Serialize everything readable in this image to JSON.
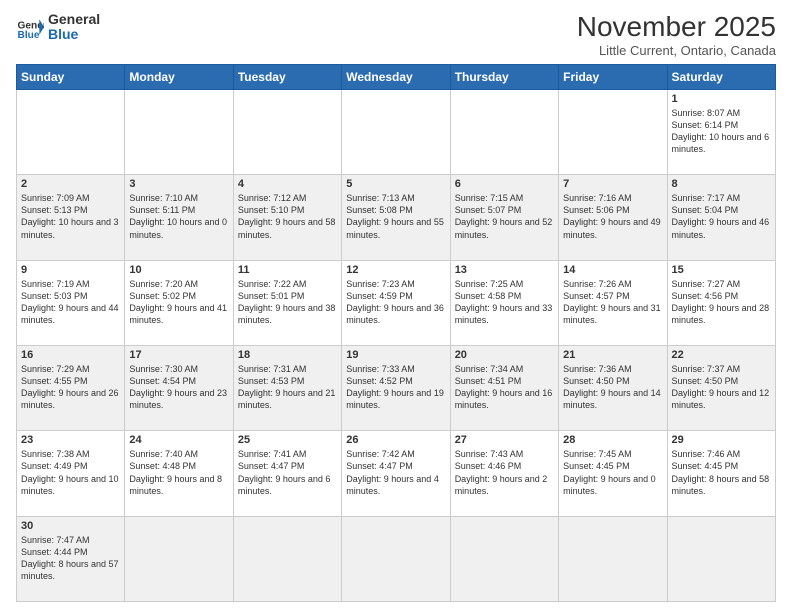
{
  "header": {
    "logo_general": "General",
    "logo_blue": "Blue",
    "month_title": "November 2025",
    "location": "Little Current, Ontario, Canada"
  },
  "weekdays": [
    "Sunday",
    "Monday",
    "Tuesday",
    "Wednesday",
    "Thursday",
    "Friday",
    "Saturday"
  ],
  "weeks": [
    [
      {
        "day": "",
        "info": ""
      },
      {
        "day": "",
        "info": ""
      },
      {
        "day": "",
        "info": ""
      },
      {
        "day": "",
        "info": ""
      },
      {
        "day": "",
        "info": ""
      },
      {
        "day": "",
        "info": ""
      },
      {
        "day": "1",
        "info": "Sunrise: 8:07 AM\nSunset: 6:14 PM\nDaylight: 10 hours\nand 6 minutes."
      }
    ],
    [
      {
        "day": "2",
        "info": "Sunrise: 7:09 AM\nSunset: 5:13 PM\nDaylight: 10 hours\nand 3 minutes."
      },
      {
        "day": "3",
        "info": "Sunrise: 7:10 AM\nSunset: 5:11 PM\nDaylight: 10 hours\nand 0 minutes."
      },
      {
        "day": "4",
        "info": "Sunrise: 7:12 AM\nSunset: 5:10 PM\nDaylight: 9 hours\nand 58 minutes."
      },
      {
        "day": "5",
        "info": "Sunrise: 7:13 AM\nSunset: 5:08 PM\nDaylight: 9 hours\nand 55 minutes."
      },
      {
        "day": "6",
        "info": "Sunrise: 7:15 AM\nSunset: 5:07 PM\nDaylight: 9 hours\nand 52 minutes."
      },
      {
        "day": "7",
        "info": "Sunrise: 7:16 AM\nSunset: 5:06 PM\nDaylight: 9 hours\nand 49 minutes."
      },
      {
        "day": "8",
        "info": "Sunrise: 7:17 AM\nSunset: 5:04 PM\nDaylight: 9 hours\nand 46 minutes."
      }
    ],
    [
      {
        "day": "9",
        "info": "Sunrise: 7:19 AM\nSunset: 5:03 PM\nDaylight: 9 hours\nand 44 minutes."
      },
      {
        "day": "10",
        "info": "Sunrise: 7:20 AM\nSunset: 5:02 PM\nDaylight: 9 hours\nand 41 minutes."
      },
      {
        "day": "11",
        "info": "Sunrise: 7:22 AM\nSunset: 5:01 PM\nDaylight: 9 hours\nand 38 minutes."
      },
      {
        "day": "12",
        "info": "Sunrise: 7:23 AM\nSunset: 4:59 PM\nDaylight: 9 hours\nand 36 minutes."
      },
      {
        "day": "13",
        "info": "Sunrise: 7:25 AM\nSunset: 4:58 PM\nDaylight: 9 hours\nand 33 minutes."
      },
      {
        "day": "14",
        "info": "Sunrise: 7:26 AM\nSunset: 4:57 PM\nDaylight: 9 hours\nand 31 minutes."
      },
      {
        "day": "15",
        "info": "Sunrise: 7:27 AM\nSunset: 4:56 PM\nDaylight: 9 hours\nand 28 minutes."
      }
    ],
    [
      {
        "day": "16",
        "info": "Sunrise: 7:29 AM\nSunset: 4:55 PM\nDaylight: 9 hours\nand 26 minutes."
      },
      {
        "day": "17",
        "info": "Sunrise: 7:30 AM\nSunset: 4:54 PM\nDaylight: 9 hours\nand 23 minutes."
      },
      {
        "day": "18",
        "info": "Sunrise: 7:31 AM\nSunset: 4:53 PM\nDaylight: 9 hours\nand 21 minutes."
      },
      {
        "day": "19",
        "info": "Sunrise: 7:33 AM\nSunset: 4:52 PM\nDaylight: 9 hours\nand 19 minutes."
      },
      {
        "day": "20",
        "info": "Sunrise: 7:34 AM\nSunset: 4:51 PM\nDaylight: 9 hours\nand 16 minutes."
      },
      {
        "day": "21",
        "info": "Sunrise: 7:36 AM\nSunset: 4:50 PM\nDaylight: 9 hours\nand 14 minutes."
      },
      {
        "day": "22",
        "info": "Sunrise: 7:37 AM\nSunset: 4:50 PM\nDaylight: 9 hours\nand 12 minutes."
      }
    ],
    [
      {
        "day": "23",
        "info": "Sunrise: 7:38 AM\nSunset: 4:49 PM\nDaylight: 9 hours\nand 10 minutes."
      },
      {
        "day": "24",
        "info": "Sunrise: 7:40 AM\nSunset: 4:48 PM\nDaylight: 9 hours\nand 8 minutes."
      },
      {
        "day": "25",
        "info": "Sunrise: 7:41 AM\nSunset: 4:47 PM\nDaylight: 9 hours\nand 6 minutes."
      },
      {
        "day": "26",
        "info": "Sunrise: 7:42 AM\nSunset: 4:47 PM\nDaylight: 9 hours\nand 4 minutes."
      },
      {
        "day": "27",
        "info": "Sunrise: 7:43 AM\nSunset: 4:46 PM\nDaylight: 9 hours\nand 2 minutes."
      },
      {
        "day": "28",
        "info": "Sunrise: 7:45 AM\nSunset: 4:45 PM\nDaylight: 9 hours\nand 0 minutes."
      },
      {
        "day": "29",
        "info": "Sunrise: 7:46 AM\nSunset: 4:45 PM\nDaylight: 8 hours\nand 58 minutes."
      }
    ],
    [
      {
        "day": "30",
        "info": "Sunrise: 7:47 AM\nSunset: 4:44 PM\nDaylight: 8 hours\nand 57 minutes."
      },
      {
        "day": "",
        "info": ""
      },
      {
        "day": "",
        "info": ""
      },
      {
        "day": "",
        "info": ""
      },
      {
        "day": "",
        "info": ""
      },
      {
        "day": "",
        "info": ""
      },
      {
        "day": "",
        "info": ""
      }
    ]
  ]
}
